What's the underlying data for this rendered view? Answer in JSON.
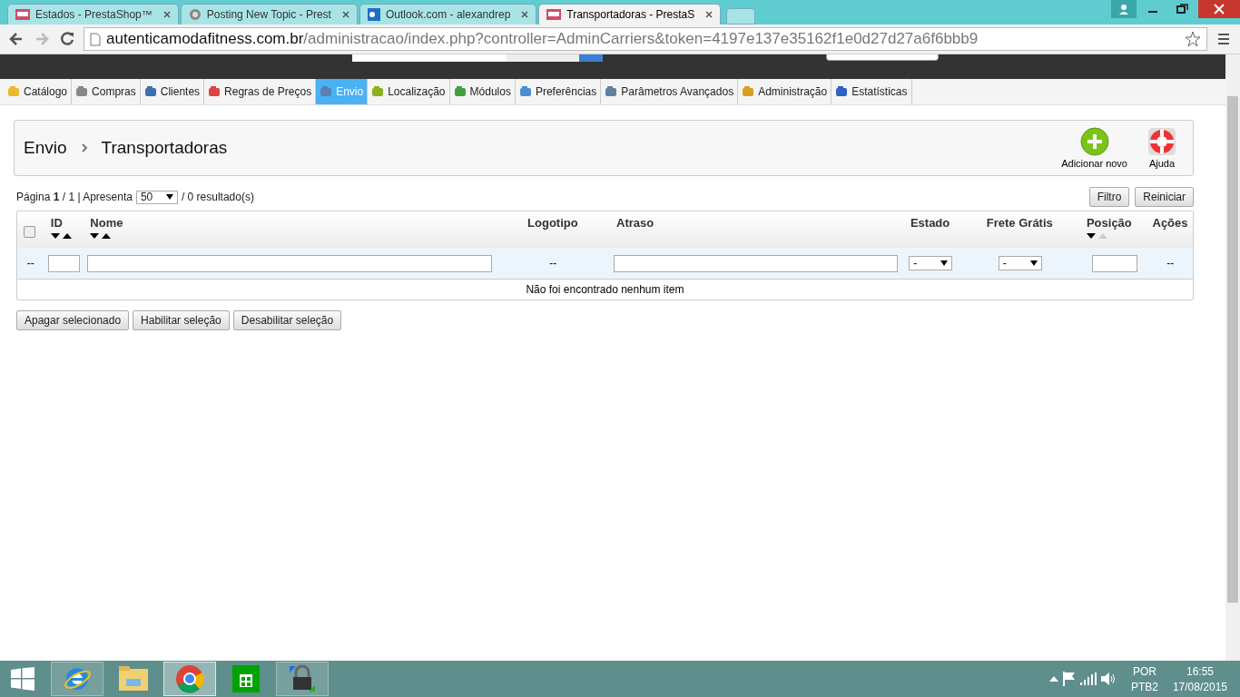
{
  "browser_tabs": [
    {
      "title": "Estados - PrestaShop™",
      "selected": false,
      "kind": "shop"
    },
    {
      "title": "Posting New Topic - Prest",
      "selected": false,
      "kind": "forum"
    },
    {
      "title": "Outlook.com - alexandrep",
      "selected": false,
      "kind": "mail"
    },
    {
      "title": "Transportadoras - PrestaS",
      "selected": true,
      "kind": "shop"
    }
  ],
  "address_bar": {
    "domain": "autenticamodafitness.com.br",
    "path": "/administracao/index.php?controller=AdminCarriers&token=4197e137e35162f1e0d27d27a6f6bbb9"
  },
  "menu": [
    {
      "label": "Catálogo",
      "selected": false
    },
    {
      "label": "Compras",
      "selected": false
    },
    {
      "label": "Clientes",
      "selected": false
    },
    {
      "label": "Regras de Preços",
      "selected": false
    },
    {
      "label": "Envio",
      "selected": true
    },
    {
      "label": "Localização",
      "selected": false
    },
    {
      "label": "Módulos",
      "selected": false
    },
    {
      "label": "Preferências",
      "selected": false
    },
    {
      "label": "Parâmetros Avançados",
      "selected": false
    },
    {
      "label": "Administração",
      "selected": false
    },
    {
      "label": "Estatísticas",
      "selected": false
    }
  ],
  "breadcrumb": [
    "Envio",
    "Transportadoras"
  ],
  "toolbar": [
    {
      "label": "Adicionar novo",
      "kind": "add"
    },
    {
      "label": "Ajuda",
      "kind": "help"
    }
  ],
  "pagination": {
    "summary": "Página **1** / 1 | Apresenta",
    "per_page": "50",
    "results": "/ 0 resultado(s)"
  },
  "filter_buttons": [
    "Filtro",
    "Reiniciar"
  ],
  "table": {
    "select_all_checked": false,
    "columns": [
      {
        "label": "ID",
        "kind": "sort",
        "sort_down": true,
        "sort_up": true
      },
      {
        "label": "Nome",
        "kind": "sort",
        "sort_down": true,
        "sort_up": true
      },
      {
        "label": "Logotipo",
        "kind": "plain"
      },
      {
        "label": "Atraso",
        "kind": "plain"
      },
      {
        "label": "Estado",
        "kind": "plain"
      },
      {
        "label": "Frete Grátis",
        "kind": "plain"
      },
      {
        "label": "Posição",
        "kind": "sort",
        "sort_down": true,
        "sort_up": false
      },
      {
        "label": "Ações",
        "kind": "plain"
      }
    ],
    "filters": [
      {
        "kind": "dash",
        "text": "--"
      },
      {
        "kind": "input"
      },
      {
        "kind": "input"
      },
      {
        "kind": "dash",
        "text": "--"
      },
      {
        "kind": "input"
      },
      {
        "kind": "select",
        "value": "-"
      },
      {
        "kind": "select",
        "value": "-"
      },
      {
        "kind": "input"
      },
      {
        "kind": "dash",
        "text": "--"
      }
    ],
    "empty_message": "Não foi encontrado nenhum item"
  },
  "bulk_actions": [
    "Apagar selecionado",
    "Habilitar seleção",
    "Desabilitar seleção"
  ],
  "taskbar": {
    "apps": [
      {
        "kind": "ie",
        "selected": false,
        "open": true
      },
      {
        "kind": "explorer",
        "selected": false,
        "open": false
      },
      {
        "kind": "chrome",
        "selected": true,
        "open": true
      },
      {
        "kind": "store",
        "selected": false,
        "open": false
      },
      {
        "kind": "lock",
        "selected": false,
        "open": true
      }
    ],
    "language": "POR",
    "layout": "PTB2",
    "time": "16:55",
    "date": "17/08/2015"
  }
}
